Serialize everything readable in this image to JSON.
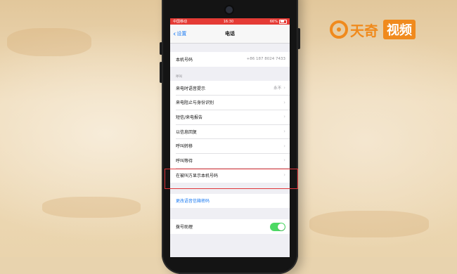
{
  "status_bar": {
    "carrier": "中国移动",
    "time": "16:30",
    "battery": "66%"
  },
  "nav": {
    "back_label": "设置",
    "title": "电话"
  },
  "my_number": {
    "label": "本机号码",
    "value": "+86 187 8024 7433"
  },
  "calls_section": {
    "header": "呼叫",
    "rows": [
      {
        "label": "来电时语音提示",
        "value": "永不"
      },
      {
        "label": "来电阻止与身份识别",
        "value": ""
      },
      {
        "label": "短信/来电报告",
        "value": ""
      },
      {
        "label": "以信息回复",
        "value": ""
      },
      {
        "label": "呼叫转移",
        "value": ""
      },
      {
        "label": "呼叫等待",
        "value": ""
      },
      {
        "label": "在被叫方显示本机号码",
        "value": ""
      }
    ]
  },
  "voicemail": {
    "change_password_label": "更改语音信箱密码"
  },
  "dial_assist": {
    "label": "拨号助理",
    "enabled": true
  },
  "watermark": {
    "brand": "天奇",
    "brand_box": "视频"
  },
  "colors": {
    "accent": "#1e7cf2",
    "highlight": "#e0363a",
    "brand": "#f08a1d",
    "toggle_on": "#4cd964"
  }
}
